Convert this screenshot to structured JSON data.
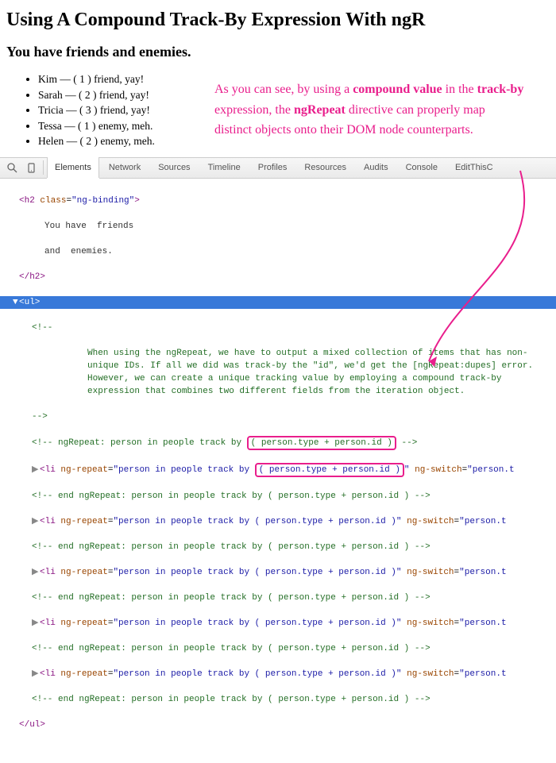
{
  "title": "Using A Compound Track-By Expression With ngR",
  "subtitle": "You have friends and enemies.",
  "people": [
    {
      "name": "Kim",
      "line": "Kim — ( 1 ) friend, yay!"
    },
    {
      "name": "Sarah",
      "line": "Sarah — ( 2 ) friend, yay!"
    },
    {
      "name": "Tricia",
      "line": "Tricia — ( 3 ) friend, yay!"
    },
    {
      "name": "Tessa",
      "line": "Tessa — ( 1 ) enemy, meh."
    },
    {
      "name": "Helen",
      "line": "Helen — ( 2 ) enemy, meh."
    }
  ],
  "annotation_html": "As you can see, by using a <b>compound value</b> in the <b>track-by</b> expression, the <b>ngRepeat</b> directive can properly map distinct objects onto their DOM node counterparts.",
  "devtools": {
    "tabs": [
      "Elements",
      "Network",
      "Sources",
      "Timeline",
      "Profiles",
      "Resources",
      "Audits",
      "Console",
      "EditThisC"
    ],
    "active_tab": "Elements",
    "h2_open": "<h2 class=\"ng-binding\">",
    "h2_line1": "You have  friends",
    "h2_line2": "and  enemies.",
    "h2_close": "</h2>",
    "ul_open": "<ul>",
    "comment_open": "<!--",
    "comment_body": "When using the ngRepeat, we have to output a mixed collection of items that has non-unique IDs. If all we did was track-by the \"id\", we'd get the [ngRepeat:dupes] error. However, we can create a unique tracking value by employing a compound track-by expression that combines two different fields from the iteration object.",
    "comment_close": "-->",
    "ngrepeat_comment_prefix": "<!-- ngRepeat: person in people track by ",
    "ngrepeat_comment_expr": "( person.type + person.id )",
    "ngrepeat_comment_suffix": " -->",
    "li_prefix": "<li ng-repeat=\"person in people track by ",
    "li_expr_plain": "( person.type + person.id )",
    "li_suffix": "\" ng-switch=\"person.t",
    "end_comment": "<!-- end ngRepeat: person in people track by ( person.type + person.id ) -->",
    "ul_close": "</ul>"
  }
}
